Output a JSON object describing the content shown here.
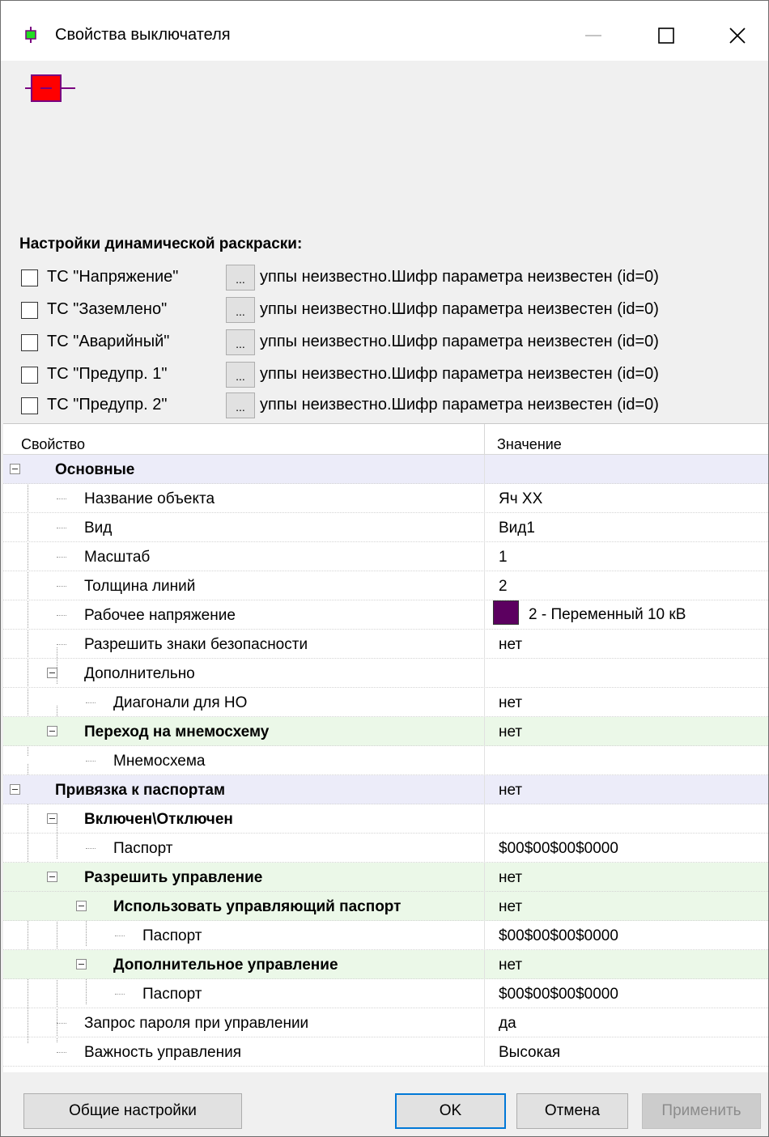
{
  "window": {
    "title": "Свойства выключателя",
    "controls": {
      "minimize": "—",
      "maximize": "□",
      "close": "✕"
    }
  },
  "dynamic": {
    "title": "Настройки динамической раскраски:",
    "browse_label": "...",
    "items": [
      {
        "label": "ТС \"Напряжение\"",
        "value": "уппы неизвестно.Шифр параметра неизвестен (id=0)",
        "checked": false
      },
      {
        "label": "ТС \"Заземлено\"",
        "value": "уппы неизвестно.Шифр параметра неизвестен (id=0)",
        "checked": false
      },
      {
        "label": "ТС \"Аварийный\"",
        "value": "уппы неизвестно.Шифр параметра неизвестен (id=0)",
        "checked": false
      },
      {
        "label": "ТС \"Предупр. 1\"",
        "value": "уппы неизвестно.Шифр параметра неизвестен (id=0)",
        "checked": false
      },
      {
        "label": "ТС \"Предупр. 2\"",
        "value": "уппы неизвестно.Шифр параметра неизвестен (id=0)",
        "checked": false
      }
    ]
  },
  "grid": {
    "headers": {
      "property": "Свойство",
      "value": "Значение"
    },
    "rows": [
      {
        "name": "Основные",
        "value": ""
      },
      {
        "name": "Название объекта",
        "value": "Яч XX"
      },
      {
        "name": "Вид",
        "value": "Вид1"
      },
      {
        "name": "Масштаб",
        "value": "1"
      },
      {
        "name": "Толщина линий",
        "value": "2"
      },
      {
        "name": "Рабочее напряжение",
        "value": "2 - Переменный 10 кВ",
        "swatch_color": "#5c0060"
      },
      {
        "name": "Разрешить знаки безопасности",
        "value": "нет"
      },
      {
        "name": "Дополнительно",
        "value": ""
      },
      {
        "name": "Диагонали для НО",
        "value": "нет"
      },
      {
        "name": "Переход на мнемосхему",
        "value": "нет"
      },
      {
        "name": "Мнемосхема",
        "value": ""
      },
      {
        "name": "Привязка к паспортам",
        "value": "нет"
      },
      {
        "name": "Включен\\Отключен",
        "value": ""
      },
      {
        "name": "Паспорт",
        "value": "$00$00$00$0000"
      },
      {
        "name": "Разрешить управление",
        "value": "нет"
      },
      {
        "name": "Использовать управляющий паспорт",
        "value": "нет"
      },
      {
        "name": "Паспорт",
        "value": "$00$00$00$0000"
      },
      {
        "name": "Дополнительное управление",
        "value": "нет"
      },
      {
        "name": "Паспорт",
        "value": "$00$00$00$0000"
      },
      {
        "name": "Запрос пароля при управлении",
        "value": "да"
      },
      {
        "name": "Важность управления",
        "value": "Высокая"
      }
    ]
  },
  "footer": {
    "general_label": "Общие настройки",
    "ok_label": "OK",
    "cancel_label": "Отмена",
    "apply_label": "Применить"
  },
  "colors": {
    "category_bg": "#ececf9",
    "subgroup_bg": "#ebf8e8",
    "switch_fill": "#ff0000",
    "switch_line": "#7a0080",
    "voltage_color": "#5c0060"
  }
}
